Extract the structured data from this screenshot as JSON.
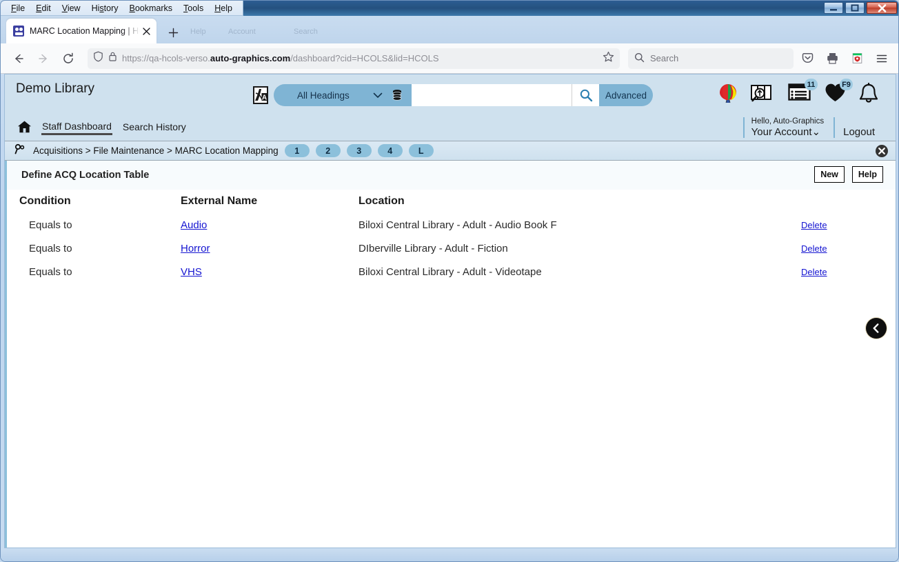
{
  "window": {
    "menus": [
      {
        "label": "File",
        "accel": "F"
      },
      {
        "label": "Edit",
        "accel": "E"
      },
      {
        "label": "View",
        "accel": "V"
      },
      {
        "label": "History",
        "accel": "s"
      },
      {
        "label": "Bookmarks",
        "accel": "B"
      },
      {
        "label": "Tools",
        "accel": "T"
      },
      {
        "label": "Help",
        "accel": "H"
      }
    ],
    "controls": {
      "minimize": "minimize-button",
      "maximize": "maximize-button",
      "close": "close-button"
    }
  },
  "browser": {
    "tab": {
      "title": "MARC Location Mapping | HCO",
      "favicon": "tab-favicon",
      "close_label": "×"
    },
    "newtab_label": "+",
    "back_icon": "back-arrow-icon",
    "forward_icon": "forward-arrow-icon",
    "reload_icon": "reload-icon",
    "url": {
      "prefix": "https://qa-hcols-verso.",
      "host": "auto-graphics.com",
      "suffix": "/dashboard?cid=HCOLS&lid=HCOLS"
    },
    "bookmark_icon": "star-icon",
    "search": {
      "placeholder": "Search",
      "icon": "search-icon"
    },
    "toolbar_icons": [
      "pocket-icon",
      "print-icon",
      "extension-shield-icon",
      "hamburger-menu-icon"
    ]
  },
  "app": {
    "brand": "Demo Library",
    "search": {
      "lang_icon": "translate-icon",
      "scope_label": "All Headings",
      "chevron_icon": "chevron-down-icon",
      "database_icon": "database-icon",
      "query_value": "",
      "go_icon": "search-icon",
      "advanced_label": "Advanced"
    },
    "header_icons": [
      {
        "name": "balloon-icon",
        "badge": ""
      },
      {
        "name": "map-search-icon",
        "badge": ""
      },
      {
        "name": "list-icon",
        "badge": "11"
      },
      {
        "name": "heart-icon",
        "badge": "F9"
      },
      {
        "name": "bell-icon",
        "badge": ""
      }
    ],
    "nav": {
      "home_icon": "home-icon",
      "links": [
        {
          "label": "Staff Dashboard",
          "active": true
        },
        {
          "label": "Search History",
          "active": false
        }
      ]
    },
    "account": {
      "hello": "Hello, Auto-Graphics",
      "name": "Your Account",
      "chevron": "⌄",
      "logout": "Logout"
    }
  },
  "breadcrumb": {
    "icon": "link-chain-icon",
    "path": "Acquisitions > File Maintenance > MARC Location Mapping",
    "steps": [
      "1",
      "2",
      "3",
      "4",
      "L"
    ],
    "close_icon": "close-circle-icon"
  },
  "panel": {
    "title": "Define ACQ Location Table",
    "buttons": [
      {
        "label": "New",
        "name": "new-button"
      },
      {
        "label": "Help",
        "name": "help-button"
      }
    ],
    "back_icon": "back-circle-icon"
  },
  "table": {
    "headers": [
      "Condition",
      "External Name",
      "Location",
      ""
    ],
    "rows": [
      {
        "condition": "Equals to",
        "external_name": "Audio",
        "location": "Biloxi Central Library - Adult - Audio Book F",
        "action": "Delete"
      },
      {
        "condition": "Equals to",
        "external_name": "Horror",
        "location": "DIberville Library - Adult - Fiction",
        "action": "Delete"
      },
      {
        "condition": "Equals to",
        "external_name": "VHS",
        "location": "Biloxi Central Library - Adult - Videotape",
        "action": "Delete"
      }
    ]
  },
  "colors": {
    "app_header_bg": "#cfe1ee",
    "accent_pill": "#7fb4d4",
    "step_dot": "#8cc0db",
    "link": "#1414d1",
    "window_chrome": "#c3d9ef"
  }
}
